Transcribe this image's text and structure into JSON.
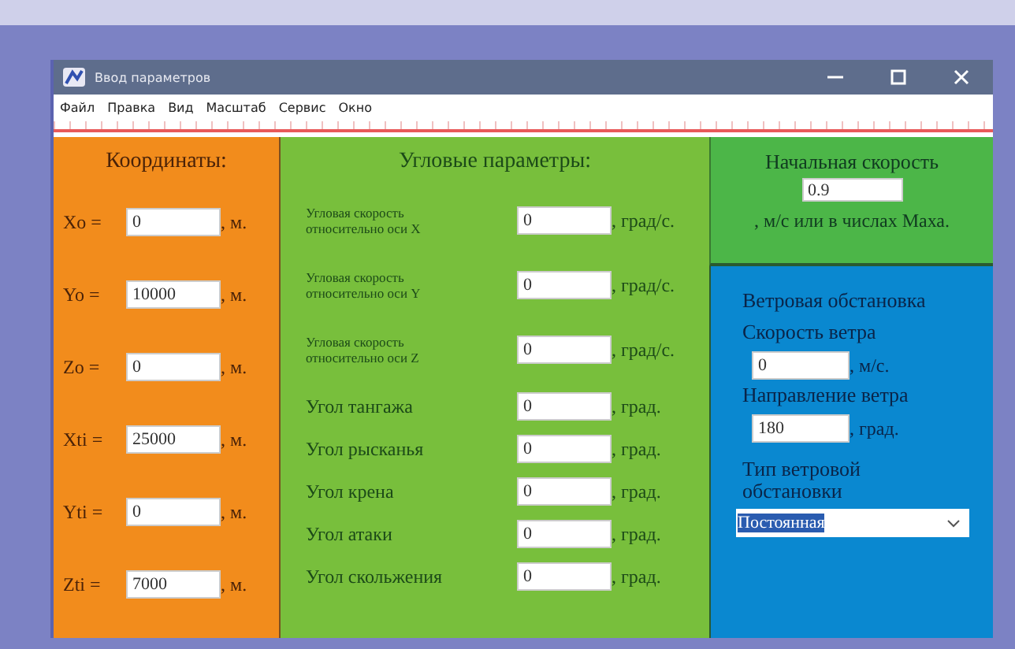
{
  "window": {
    "title": "Ввод параметров"
  },
  "menu": [
    "Файл",
    "Правка",
    "Вид",
    "Масштаб",
    "Сервис",
    "Окно"
  ],
  "coordinates": {
    "title": "Координаты:",
    "rows": [
      {
        "label": "Xo =",
        "value": "0",
        "unit": ", м."
      },
      {
        "label": "Yo =",
        "value": "10000",
        "unit": ", м."
      },
      {
        "label": "Zo =",
        "value": "0",
        "unit": ", м."
      },
      {
        "label": "Xti =",
        "value": "25000",
        "unit": ", м."
      },
      {
        "label": "Yti =",
        "value": "0",
        "unit": ", м."
      },
      {
        "label": "Zti =",
        "value": "7000",
        "unit": ", м."
      }
    ]
  },
  "angular": {
    "title": "Угловые параметры:",
    "rows": [
      {
        "kind": "rate",
        "label": "Угловая скорость\nотносительно оси X",
        "value": "0",
        "unit": ", град/с."
      },
      {
        "kind": "rate",
        "label": "Угловая скорость\nотносительно оси Y",
        "value": "0",
        "unit": ", град/с."
      },
      {
        "kind": "rate",
        "label": "Угловая скорость\nотносительно оси Z",
        "value": "0",
        "unit": ", град/с."
      },
      {
        "kind": "angle",
        "label": "Угол тангажа",
        "value": "0",
        "unit": ", град."
      },
      {
        "kind": "angle",
        "label": "Угол рысканья",
        "value": "0",
        "unit": ", град."
      },
      {
        "kind": "angle",
        "label": "Угол крена",
        "value": "0",
        "unit": ", град."
      },
      {
        "kind": "angle",
        "label": "Угол атаки",
        "value": "0",
        "unit": ", град."
      },
      {
        "kind": "angle",
        "label": "Угол скольжения",
        "value": "0",
        "unit": ", град."
      }
    ]
  },
  "initial_speed": {
    "title": "Начальная скорость",
    "value": "0.9",
    "unit": ", м/с или в числах Маха."
  },
  "wind": {
    "title": "Ветровая обстановка",
    "speed_label": "Скорость ветра",
    "speed_value": "0",
    "speed_unit": ", м/с.",
    "direction_label": "Направление ветра",
    "direction_value": "180",
    "direction_unit": ", град.",
    "type_label": "Тип ветровой обстановки",
    "type_value": "Постоянная",
    "type_highlighted": true
  }
}
